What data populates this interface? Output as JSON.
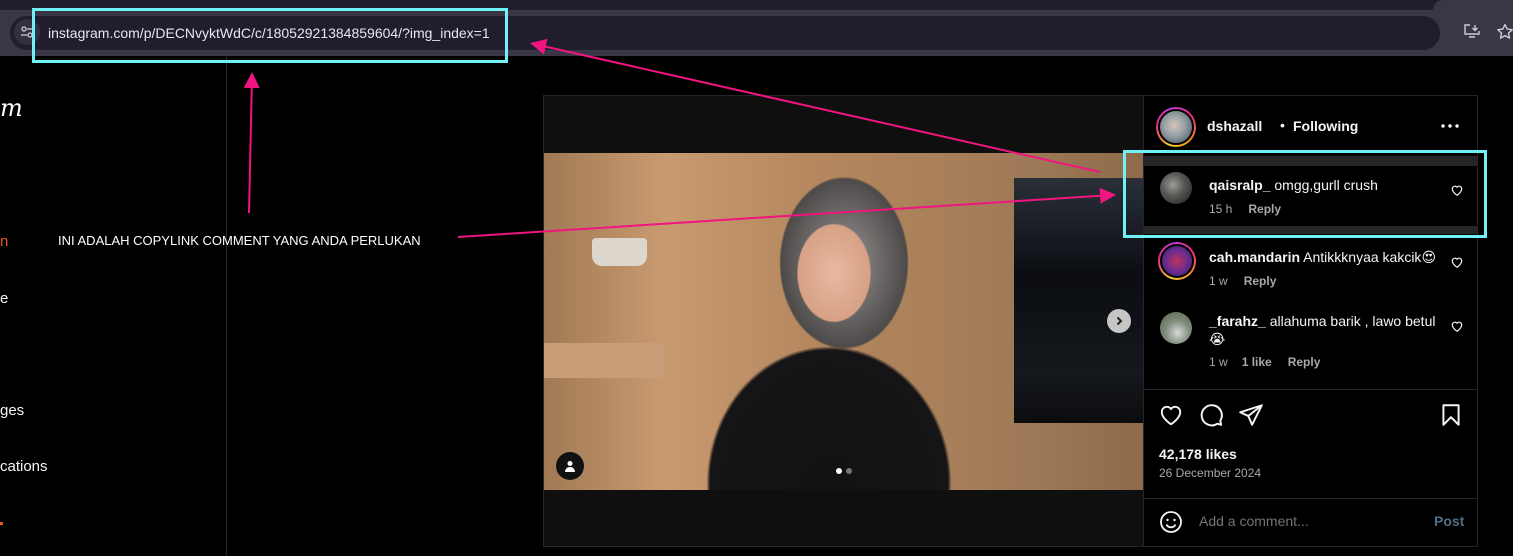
{
  "browser": {
    "url": "instagram.com/p/DECNvyktWdC/c/18052921384859604/?img_index=1",
    "site_info_icon": "tune-icon",
    "install_icon": "install-app-icon",
    "bookmark_icon": "star-icon"
  },
  "sidebar": {
    "logo": "m",
    "items": [
      {
        "label": "n",
        "color": "#e85a1b"
      },
      {
        "label": "e"
      },
      {
        "label": "ges"
      },
      {
        "label": "cations"
      }
    ]
  },
  "post": {
    "author": "dshazall",
    "separator": "•",
    "follow_status": "Following",
    "more_icon": "more-horizontal-icon",
    "carousel": {
      "current": 1,
      "total": 2
    },
    "comments": [
      {
        "username": "qaisralp_",
        "text": "omgg,gurll crush",
        "time": "15 h",
        "likes": "",
        "reply": "Reply",
        "highlighted": true
      },
      {
        "username": "cah.mandarin",
        "text": "Antikkknyaa kakcik",
        "emoji": "😍",
        "time": "1 w",
        "likes": "",
        "reply": "Reply"
      },
      {
        "username": "_farahz_",
        "text": "allahuma barik , lawo betul",
        "emoji": "😭",
        "time": "1 w",
        "likes": "1 like",
        "reply": "Reply"
      }
    ],
    "likes": "42,178 likes",
    "date": "26 December 2024",
    "comment_placeholder": "Add a comment...",
    "post_button": "Post"
  },
  "annotation": {
    "text": "INI ADALAH COPYLINK COMMENT YANG ANDA PERLUKAN",
    "highlight_color": "#6ff1f5",
    "arrow_color": "#f0157f"
  }
}
